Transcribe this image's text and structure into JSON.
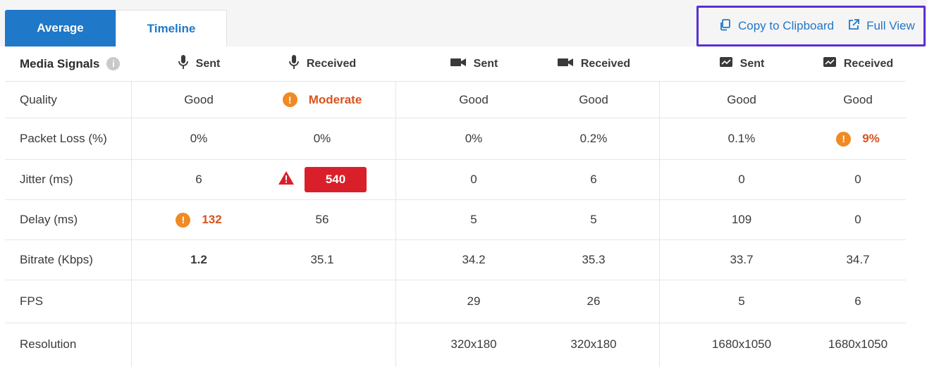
{
  "tabs": [
    {
      "label": "Average",
      "active": true
    },
    {
      "label": "Timeline",
      "active": false
    }
  ],
  "actions": {
    "copy_label": "Copy to Clipboard",
    "full_view_label": "Full View"
  },
  "table": {
    "title": "Media Signals",
    "columns": [
      {
        "icon": "microphone-icon",
        "label": "Sent"
      },
      {
        "icon": "microphone-icon",
        "label": "Received"
      },
      {
        "icon": "video-camera-icon",
        "label": "Sent"
      },
      {
        "icon": "video-camera-icon",
        "label": "Received"
      },
      {
        "icon": "screen-share-icon",
        "label": "Sent"
      },
      {
        "icon": "screen-share-icon",
        "label": "Received"
      }
    ],
    "rows": [
      {
        "label": "Quality",
        "values": [
          "Good",
          "Moderate",
          "Good",
          "Good",
          "Good",
          "Good"
        ]
      },
      {
        "label": "Packet Loss (%)",
        "values": [
          "0%",
          "0%",
          "0%",
          "0.2%",
          "0.1%",
          "9%"
        ]
      },
      {
        "label": "Jitter (ms)",
        "values": [
          "6",
          "540",
          "0",
          "6",
          "0",
          "0"
        ]
      },
      {
        "label": "Delay (ms)",
        "values": [
          "132",
          "56",
          "5",
          "5",
          "109",
          "0"
        ]
      },
      {
        "label": "Bitrate (Kbps)",
        "values": [
          "1.2",
          "35.1",
          "34.2",
          "35.3",
          "33.7",
          "34.7"
        ]
      },
      {
        "label": "FPS",
        "values": [
          "",
          "",
          "29",
          "26",
          "5",
          "6"
        ]
      },
      {
        "label": "Resolution",
        "values": [
          "",
          "",
          "320x180",
          "320x180",
          "1680x1050",
          "1680x1050"
        ]
      }
    ]
  },
  "colors": {
    "accent": "#1f78c8",
    "warning": "#f08a24",
    "critical": "#d9202a",
    "highlight_border": "#5b2fd6"
  }
}
